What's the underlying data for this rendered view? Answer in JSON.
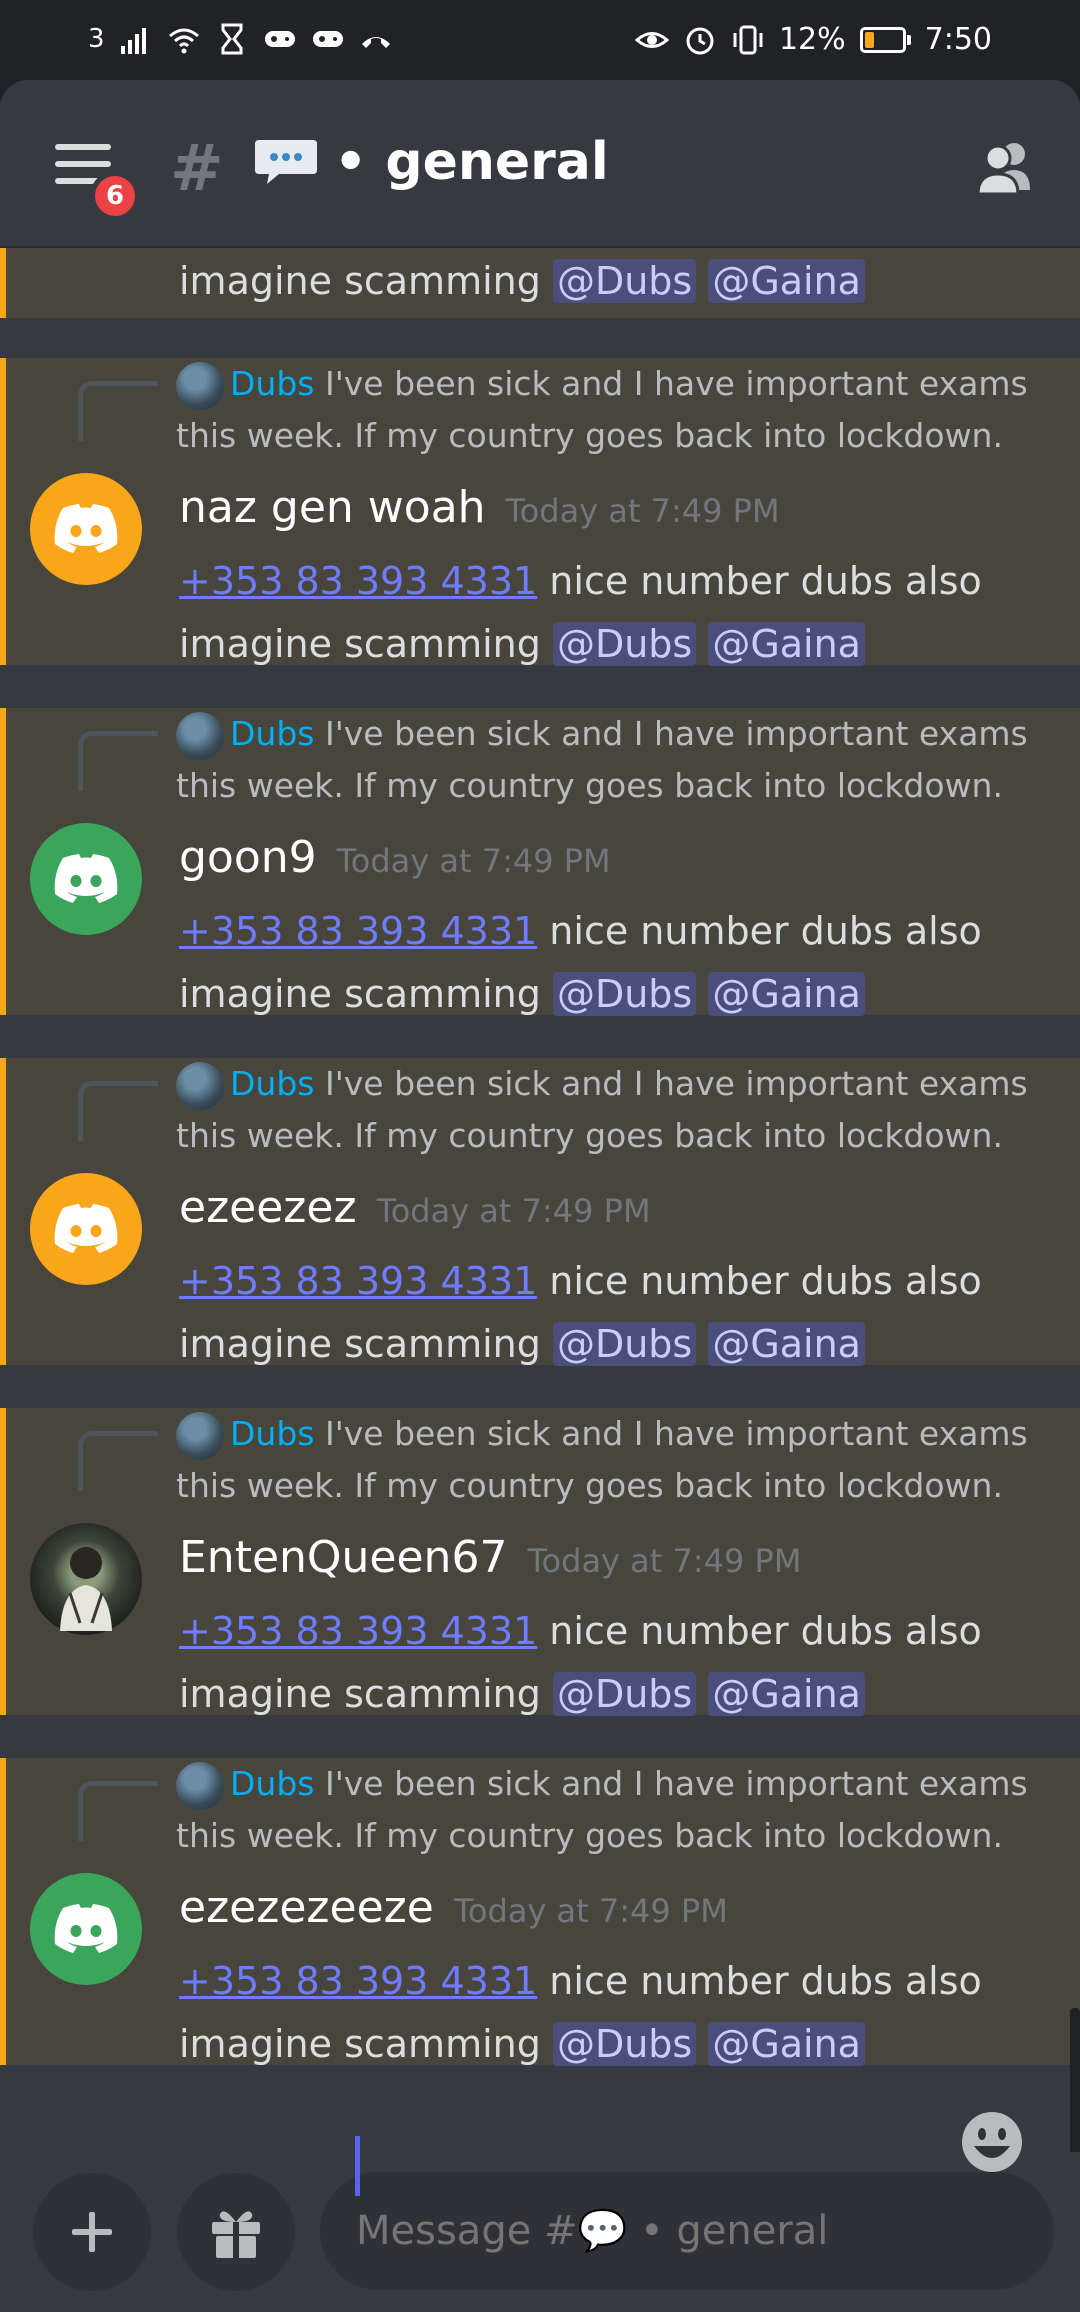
{
  "status_bar": {
    "carrier": "3",
    "battery": "12%",
    "time": "7:50"
  },
  "header": {
    "badge_count": "6",
    "hash": "#",
    "channel_name": "• general"
  },
  "messages": [
    {
      "content_line2_prefix": "imagine scamming",
      "mention1": "@Dubs",
      "mention2": "@Gaina"
    },
    {
      "reply_name": "Dubs",
      "reply_text": "I've been sick and I have important exams this week. If my country goes back into lockdown.",
      "username": "naz gen woah",
      "timestamp": "Today at 7:49 PM",
      "phone": "+353 83 393 4331",
      "text_after_phone": "nice number dubs also",
      "line2": "imagine scamming",
      "mention1": "@Dubs",
      "mention2": "@Gaina"
    },
    {
      "reply_name": "Dubs",
      "reply_text": "I've been sick and I have important exams this week. If my country goes back into lockdown.",
      "username": "goon9",
      "timestamp": "Today at 7:49 PM",
      "phone": "+353 83 393 4331",
      "text_after_phone": "nice number dubs also",
      "line2": "imagine scamming",
      "mention1": "@Dubs",
      "mention2": "@Gaina"
    },
    {
      "reply_name": "Dubs",
      "reply_text": "I've been sick and I have important exams this week. If my country goes back into lockdown.",
      "username": "ezeezez",
      "timestamp": "Today at 7:49 PM",
      "phone": "+353 83 393 4331",
      "text_after_phone": "nice number dubs also",
      "line2": "imagine scamming",
      "mention1": "@Dubs",
      "mention2": "@Gaina"
    },
    {
      "reply_name": "Dubs",
      "reply_text": "I've been sick and I have important exams this week. If my country goes back into lockdown.",
      "username": "EntenQueen67",
      "timestamp": "Today at 7:49 PM",
      "phone": "+353 83 393 4331",
      "text_after_phone": "nice number dubs also",
      "line2": "imagine scamming",
      "mention1": "@Dubs",
      "mention2": "@Gaina"
    },
    {
      "reply_name": "Dubs",
      "reply_text": "I've been sick and I have important exams this week. If my country goes back into lockdown.",
      "username": "ezezezeeze",
      "timestamp": "Today at 7:49 PM",
      "phone": "+353 83 393 4331",
      "text_after_phone": "nice number dubs also",
      "line2": "imagine scamming",
      "mention1": "@Dubs",
      "mention2": "@Gaina"
    }
  ],
  "composer": {
    "placeholder": "Message #💬 • general"
  },
  "icons": {
    "menu": "hamburger-icon",
    "members": "members-icon",
    "add": "plus-icon",
    "gift": "gift-icon",
    "emoji": "emoji-icon",
    "discord": "discord-logo-icon"
  },
  "colors": {
    "accent": "#5865f2",
    "highlight_border": "#faa61a",
    "badge": "#ed4245",
    "reply_name": "#00aff4"
  }
}
